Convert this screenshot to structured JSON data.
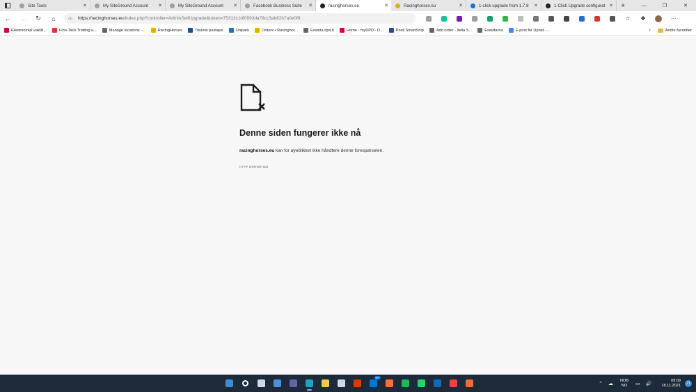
{
  "tabs": [
    {
      "label": "Site Tools",
      "color": "#9aa0a6",
      "active": false
    },
    {
      "label": "My SiteGround Account",
      "color": "#9aa0a6",
      "active": false
    },
    {
      "label": "My SiteGround Account",
      "color": "#9aa0a6",
      "active": false
    },
    {
      "label": "Facebook Business Suite",
      "color": "#9aa0a6",
      "active": false
    },
    {
      "label": "racinghorses.eu",
      "color": "#222222",
      "active": true
    },
    {
      "label": "Racinghorses.eu",
      "color": "#e2b000",
      "active": false
    },
    {
      "label": "1-click upgrade from 1.7.8",
      "color": "#1f6fd1",
      "active": false
    },
    {
      "label": "1-Click Upgrade configurat",
      "color": "#222222",
      "active": false
    }
  ],
  "address": {
    "host": "https://racinghorses.eu",
    "path": "/index.php?controller=AdminSelfUpgrade&token=75312c1df0993da78cc3ab82b7a0e0f8"
  },
  "bookmarks": [
    {
      "label": "Elektroniniai valdži...",
      "color": "#c8102e"
    },
    {
      "label": "Finn-Tack Trotting a...",
      "color": "#d33"
    },
    {
      "label": "Manage locations -...",
      "color": "#666"
    },
    {
      "label": "RacingHorses",
      "color": "#e2b000"
    },
    {
      "label": "Titulinis puslapis",
      "color": "#1a4f9c"
    },
    {
      "label": "Unipark",
      "color": "#2a6fb0"
    },
    {
      "label": "Orders • Racinghor...",
      "color": "#e2b000"
    },
    {
      "label": "Esiunta.dpd.lt",
      "color": "#666"
    },
    {
      "label": "Home - myDPD - D...",
      "color": "#dc0032"
    },
    {
      "label": "Posti SmartShip",
      "color": "#2b4c8c"
    },
    {
      "label": "Add order - Itella S...",
      "color": "#666"
    },
    {
      "label": "Esavitarna",
      "color": "#666"
    },
    {
      "label": "E-post for Upnet -...",
      "color": "#4285f4"
    }
  ],
  "other_bookmarks": "Andre favoritter",
  "error": {
    "title": "Denne siden fungerer ikke nå",
    "host": "racinghorses.eu",
    "message": " kan for øyeblikket ikke håndtere denne forespørselen.",
    "code": "HTTP ERROR 500"
  },
  "tray": {
    "lang_top": "NOB",
    "lang_bottom": "NO",
    "time": "09:09",
    "date": "18.11.2021",
    "notifications": "21",
    "chat_badge": "99+"
  },
  "extensions": [
    {
      "name": "ext-1",
      "color": "#9aa0a6"
    },
    {
      "name": "grammarly",
      "color": "#15c39a"
    },
    {
      "name": "onenote",
      "color": "#7719aa"
    },
    {
      "name": "ext-4",
      "color": "#9aa0a6"
    },
    {
      "name": "ext-5",
      "color": "#15a06b"
    },
    {
      "name": "ext-6",
      "color": "#2db84d"
    },
    {
      "name": "ext-7",
      "color": "#bbbbbb"
    },
    {
      "name": "ext-8",
      "color": "#777777"
    },
    {
      "name": "ext-9",
      "color": "#555555"
    },
    {
      "name": "ext-10",
      "color": "#444444"
    },
    {
      "name": "ext-11",
      "color": "#1f6fd1"
    },
    {
      "name": "ext-12",
      "color": "#d33"
    },
    {
      "name": "ext-13",
      "color": "#555555"
    }
  ],
  "taskbar": [
    {
      "name": "start",
      "color": "#3b8ed8"
    },
    {
      "name": "search",
      "color": "#ffffff"
    },
    {
      "name": "task-view",
      "color": "#cfd8e3"
    },
    {
      "name": "widgets",
      "color": "#4a90e2"
    },
    {
      "name": "teams-chat",
      "color": "#6264a7"
    },
    {
      "name": "edge",
      "color": "#1fa0c8"
    },
    {
      "name": "file-explorer",
      "color": "#f2c94c"
    },
    {
      "name": "store",
      "color": "#cfd8e3"
    },
    {
      "name": "office",
      "color": "#d83b01"
    },
    {
      "name": "skype",
      "color": "#0078d4"
    },
    {
      "name": "firefox",
      "color": "#ff7139"
    },
    {
      "name": "spotify",
      "color": "#1db954"
    },
    {
      "name": "whatsapp",
      "color": "#25d366"
    },
    {
      "name": "outlook",
      "color": "#0f6cbd"
    },
    {
      "name": "chrome",
      "color": "#e8453c"
    },
    {
      "name": "app",
      "color": "#f06a35"
    }
  ]
}
